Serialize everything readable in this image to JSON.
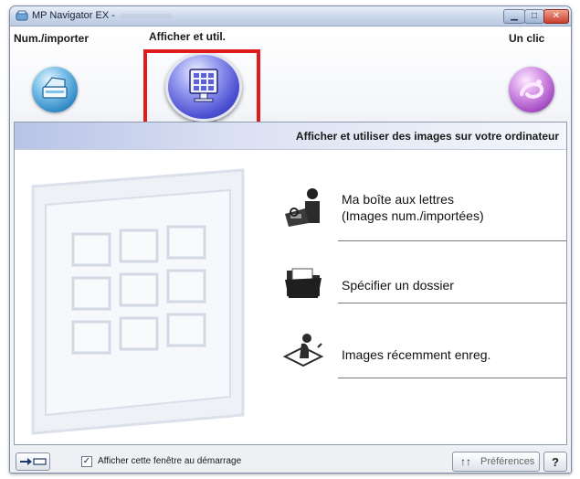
{
  "window": {
    "title": "MP Navigator EX -"
  },
  "header": {
    "modes": [
      {
        "label": "Num./importer"
      },
      {
        "label": "Afficher et util."
      },
      {
        "label": "Un clic"
      }
    ],
    "selected_mode": "Afficher et util."
  },
  "panel": {
    "heading": "Afficher et utiliser des images sur votre ordinateur",
    "items": [
      {
        "label_line1": "Ma boîte aux lettres",
        "label_line2": "(Images num./importées)",
        "icon": "mailbox-fax-icon"
      },
      {
        "label": "Spécifier un dossier",
        "icon": "folder-icon"
      },
      {
        "label": "Images récemment enreg.",
        "icon": "recent-images-icon"
      }
    ]
  },
  "footer": {
    "checkbox_label": "Afficher cette fenêtre au démarrage",
    "checkbox_checked": true,
    "preferences_label": "Préférences",
    "help_label": "?"
  },
  "colors": {
    "highlight": "#e11b1b",
    "band_accent": "#b8c3e6",
    "scan_orb": "#2f88c4",
    "view_orb": "#4b4fd2",
    "oneclick_orb": "#a24ac2"
  }
}
